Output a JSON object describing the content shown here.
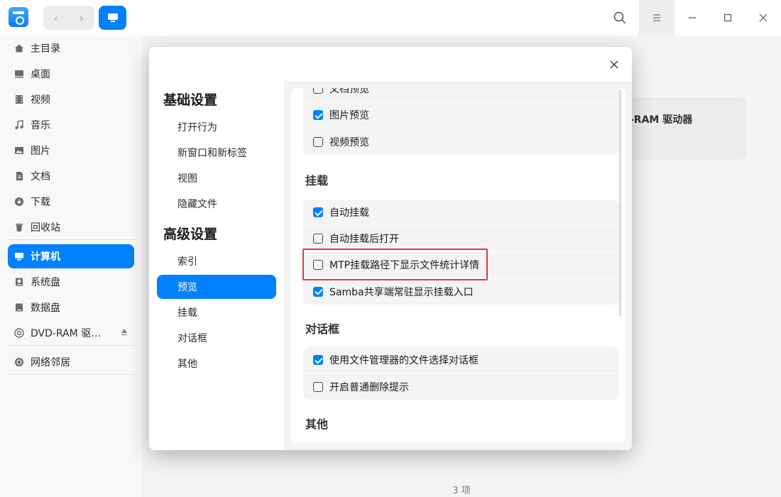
{
  "titlebar": {
    "nav_back": "‹",
    "nav_forward": "›"
  },
  "sidebar": {
    "items": [
      {
        "label": "主目录",
        "icon": "home-icon"
      },
      {
        "label": "桌面",
        "icon": "desktop-icon"
      },
      {
        "label": "视频",
        "icon": "video-icon"
      },
      {
        "label": "音乐",
        "icon": "music-icon"
      },
      {
        "label": "图片",
        "icon": "picture-icon"
      },
      {
        "label": "文档",
        "icon": "document-icon"
      },
      {
        "label": "下载",
        "icon": "download-icon"
      },
      {
        "label": "回收站",
        "icon": "trash-icon"
      }
    ],
    "devices": [
      {
        "label": "计算机",
        "icon": "computer-icon",
        "active": true
      },
      {
        "label": "系统盘",
        "icon": "disk-icon"
      },
      {
        "label": "数据盘",
        "icon": "disk-icon"
      },
      {
        "label": "DVD-RAM 驱…",
        "icon": "optical-disc-icon"
      }
    ],
    "network": {
      "label": "网络邻居",
      "icon": "network-icon"
    }
  },
  "main": {
    "card_label": "-RAM 驱动器",
    "status": "3 项"
  },
  "dialog": {
    "nav": {
      "basic_heading": "基础设置",
      "basic_items": [
        "打开行为",
        "新窗口和新标签",
        "视图",
        "隐藏文件"
      ],
      "advanced_heading": "高级设置",
      "advanced_items": [
        "索引",
        "预览",
        "挂载",
        "对话框",
        "其他"
      ],
      "active_item": "预览"
    },
    "preview_group": [
      {
        "label": "文档预览",
        "checked": false
      },
      {
        "label": "图片预览",
        "checked": true
      },
      {
        "label": "视频预览",
        "checked": false
      }
    ],
    "mount_title": "挂载",
    "mount_group": [
      {
        "label": "自动挂载",
        "checked": true
      },
      {
        "label": "自动挂载后打开",
        "checked": false
      },
      {
        "label": "MTP挂载路径下显示文件统计详情",
        "checked": false
      },
      {
        "label": "Samba共享端常驻显示挂载入口",
        "checked": true
      }
    ],
    "dialog_title": "对话框",
    "dialog_group": [
      {
        "label": "使用文件管理器的文件选择对话框",
        "checked": true
      },
      {
        "label": "开启普通删除提示",
        "checked": false
      }
    ],
    "other_title": "其他"
  },
  "colors": {
    "accent": "#0081ff",
    "highlight": "#e8354a"
  }
}
